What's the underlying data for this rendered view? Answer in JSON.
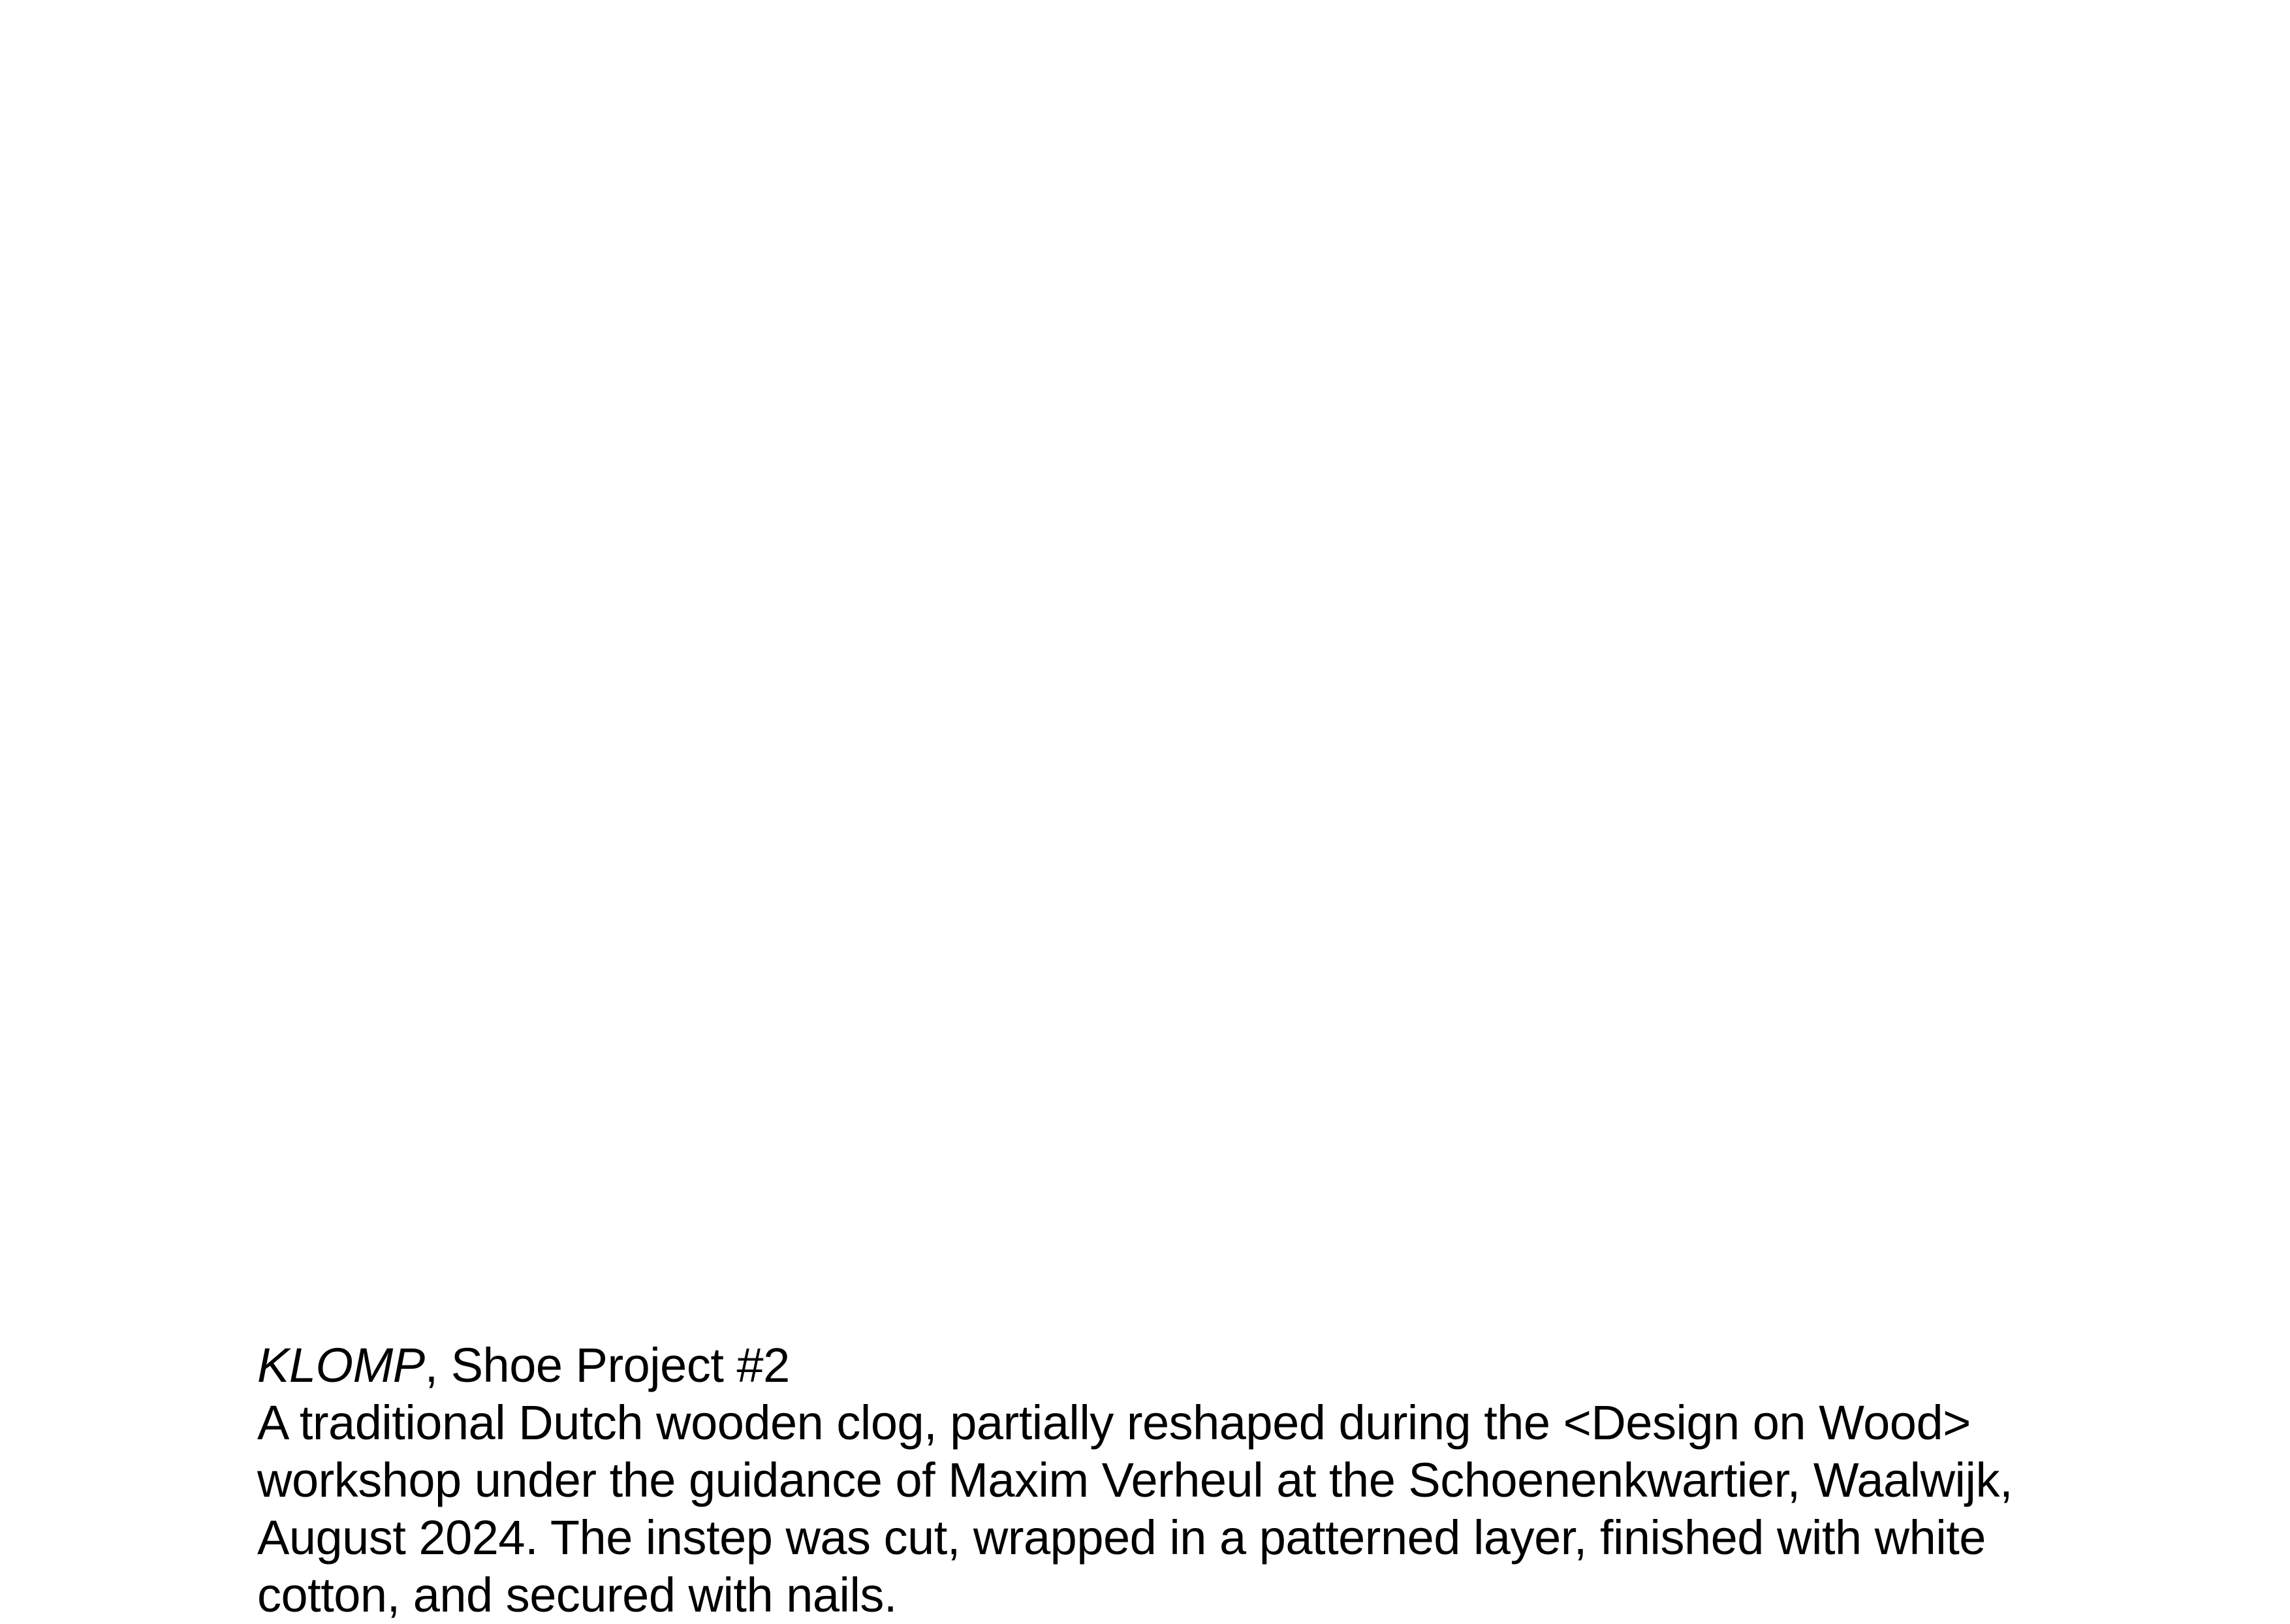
{
  "caption": {
    "work_title": "KLOMP",
    "title_suffix": ", Shoe Project #2",
    "description_lines": [
      "A traditional Dutch wooden clog, partially reshaped during the <Design on Wood>",
      "workshop under the guidance of Maxim Verheul at the Schoenenkwartier, Waalwijk,",
      "August 2024. The instep was cut, wrapped in a patterned layer, finished with white",
      "cotton, and secured with nails."
    ]
  }
}
